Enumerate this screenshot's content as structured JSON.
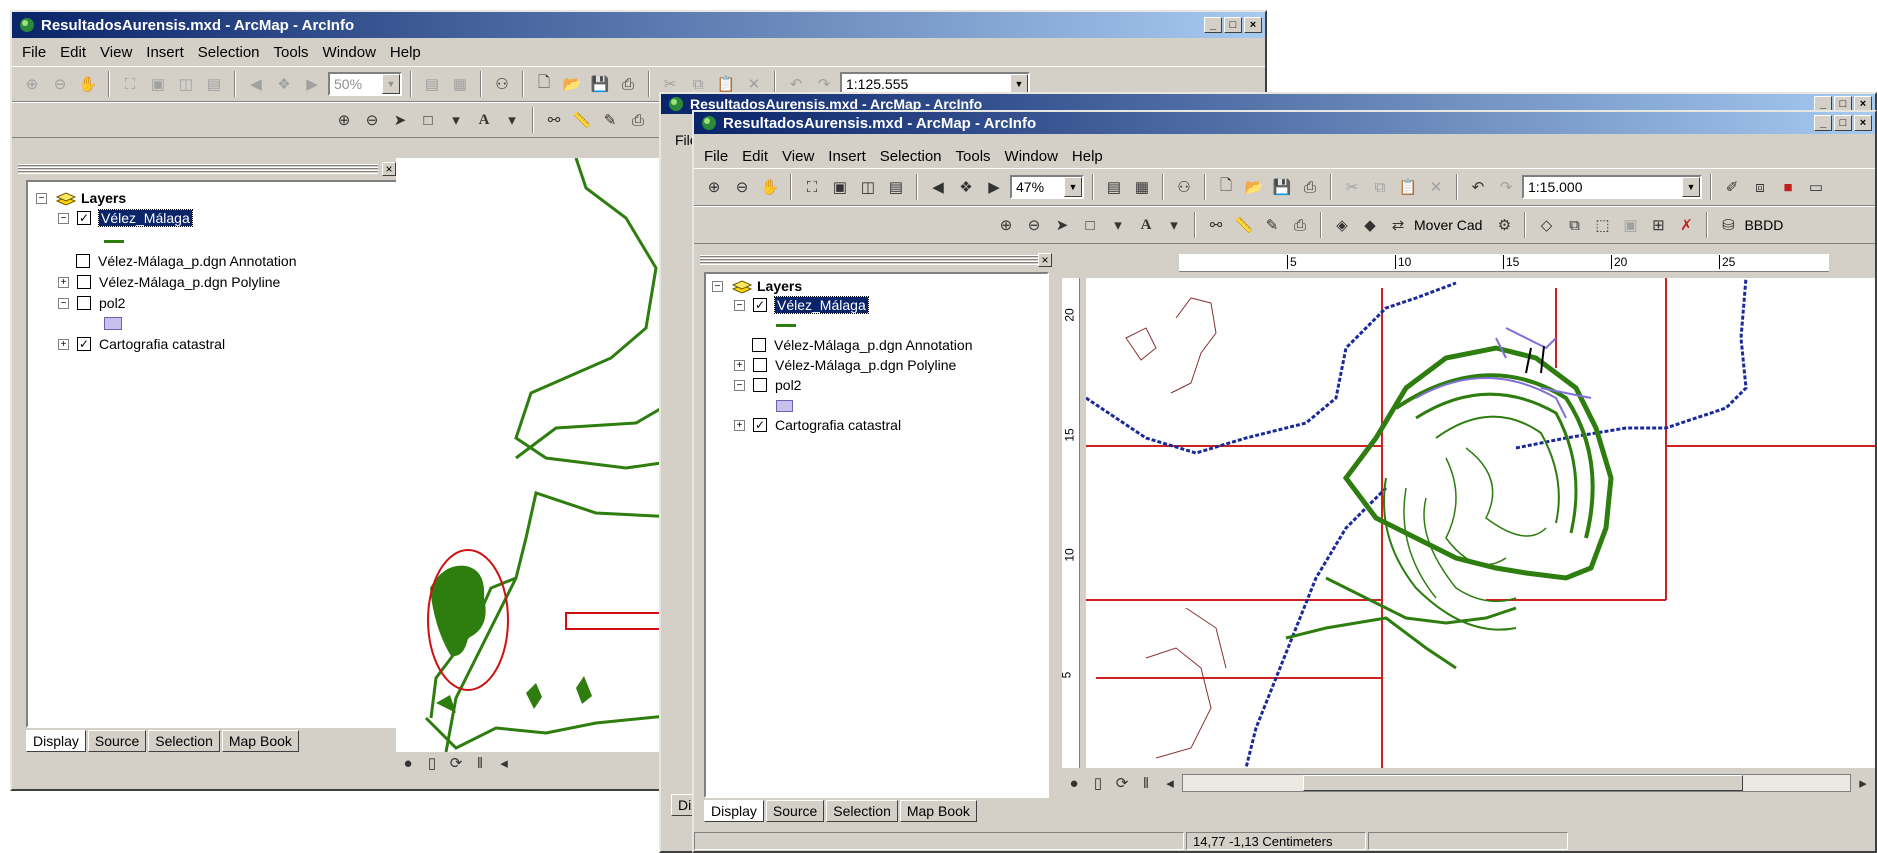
{
  "back_window": {
    "title": "ResultadosAurensis.mxd - ArcMap - ArcInfo",
    "menu": [
      "File",
      "Edit",
      "View",
      "Insert",
      "Selection",
      "Tools",
      "Window",
      "Help"
    ],
    "zoom": "50%",
    "scale": "1:125.555",
    "toc_root": "Layers",
    "layers": [
      {
        "name": "Vélez_Málaga",
        "checked": true,
        "selected": true
      },
      {
        "name": "Vélez-Málaga_p.dgn Annotation",
        "checked": false
      },
      {
        "name": "Vélez-Málaga_p.dgn Polyline",
        "checked": false
      },
      {
        "name": "pol2",
        "checked": false
      },
      {
        "name": "Cartografia catastral",
        "checked": true
      }
    ],
    "tabs": [
      "Display",
      "Source",
      "Selection",
      "Map Book"
    ]
  },
  "middle_window": {
    "title": "ResultadosAurensis.mxd - ArcMap - ArcInfo",
    "menu_stub": "File",
    "tab_stub": "Dis"
  },
  "front_window": {
    "title": "ResultadosAurensis.mxd - ArcMap - ArcInfo",
    "menu": [
      "File",
      "Edit",
      "View",
      "Insert",
      "Selection",
      "Tools",
      "Window",
      "Help"
    ],
    "zoom": "47%",
    "scale": "1:15.000",
    "mover_cad": "Mover Cad",
    "bbdd": "BBDD",
    "toc_root": "Layers",
    "layers": [
      {
        "name": "Vélez_Málaga",
        "checked": true,
        "selected": true
      },
      {
        "name": "Vélez-Málaga_p.dgn Annotation",
        "checked": false
      },
      {
        "name": "Vélez-Málaga_p.dgn Polyline",
        "checked": false
      },
      {
        "name": "pol2",
        "checked": false
      },
      {
        "name": "Cartografia catastral",
        "checked": true
      }
    ],
    "tabs": [
      "Display",
      "Source",
      "Selection",
      "Map Book"
    ],
    "ruler_h": [
      "5",
      "10",
      "15",
      "20",
      "25"
    ],
    "ruler_v": [
      "20",
      "15",
      "10",
      "5"
    ],
    "coordinates": "14,77  -1,13 Centimeters"
  },
  "colors": {
    "title_start": "#0a246a",
    "title_end": "#a6caf0",
    "chrome": "#d4d0c8",
    "layer_green": "#2e7d0f",
    "cadastre_red": "#d02020",
    "river_blue": "#1a2a9a",
    "highlight_red": "#d01010",
    "pol2_fill": "#c8c0ee"
  }
}
